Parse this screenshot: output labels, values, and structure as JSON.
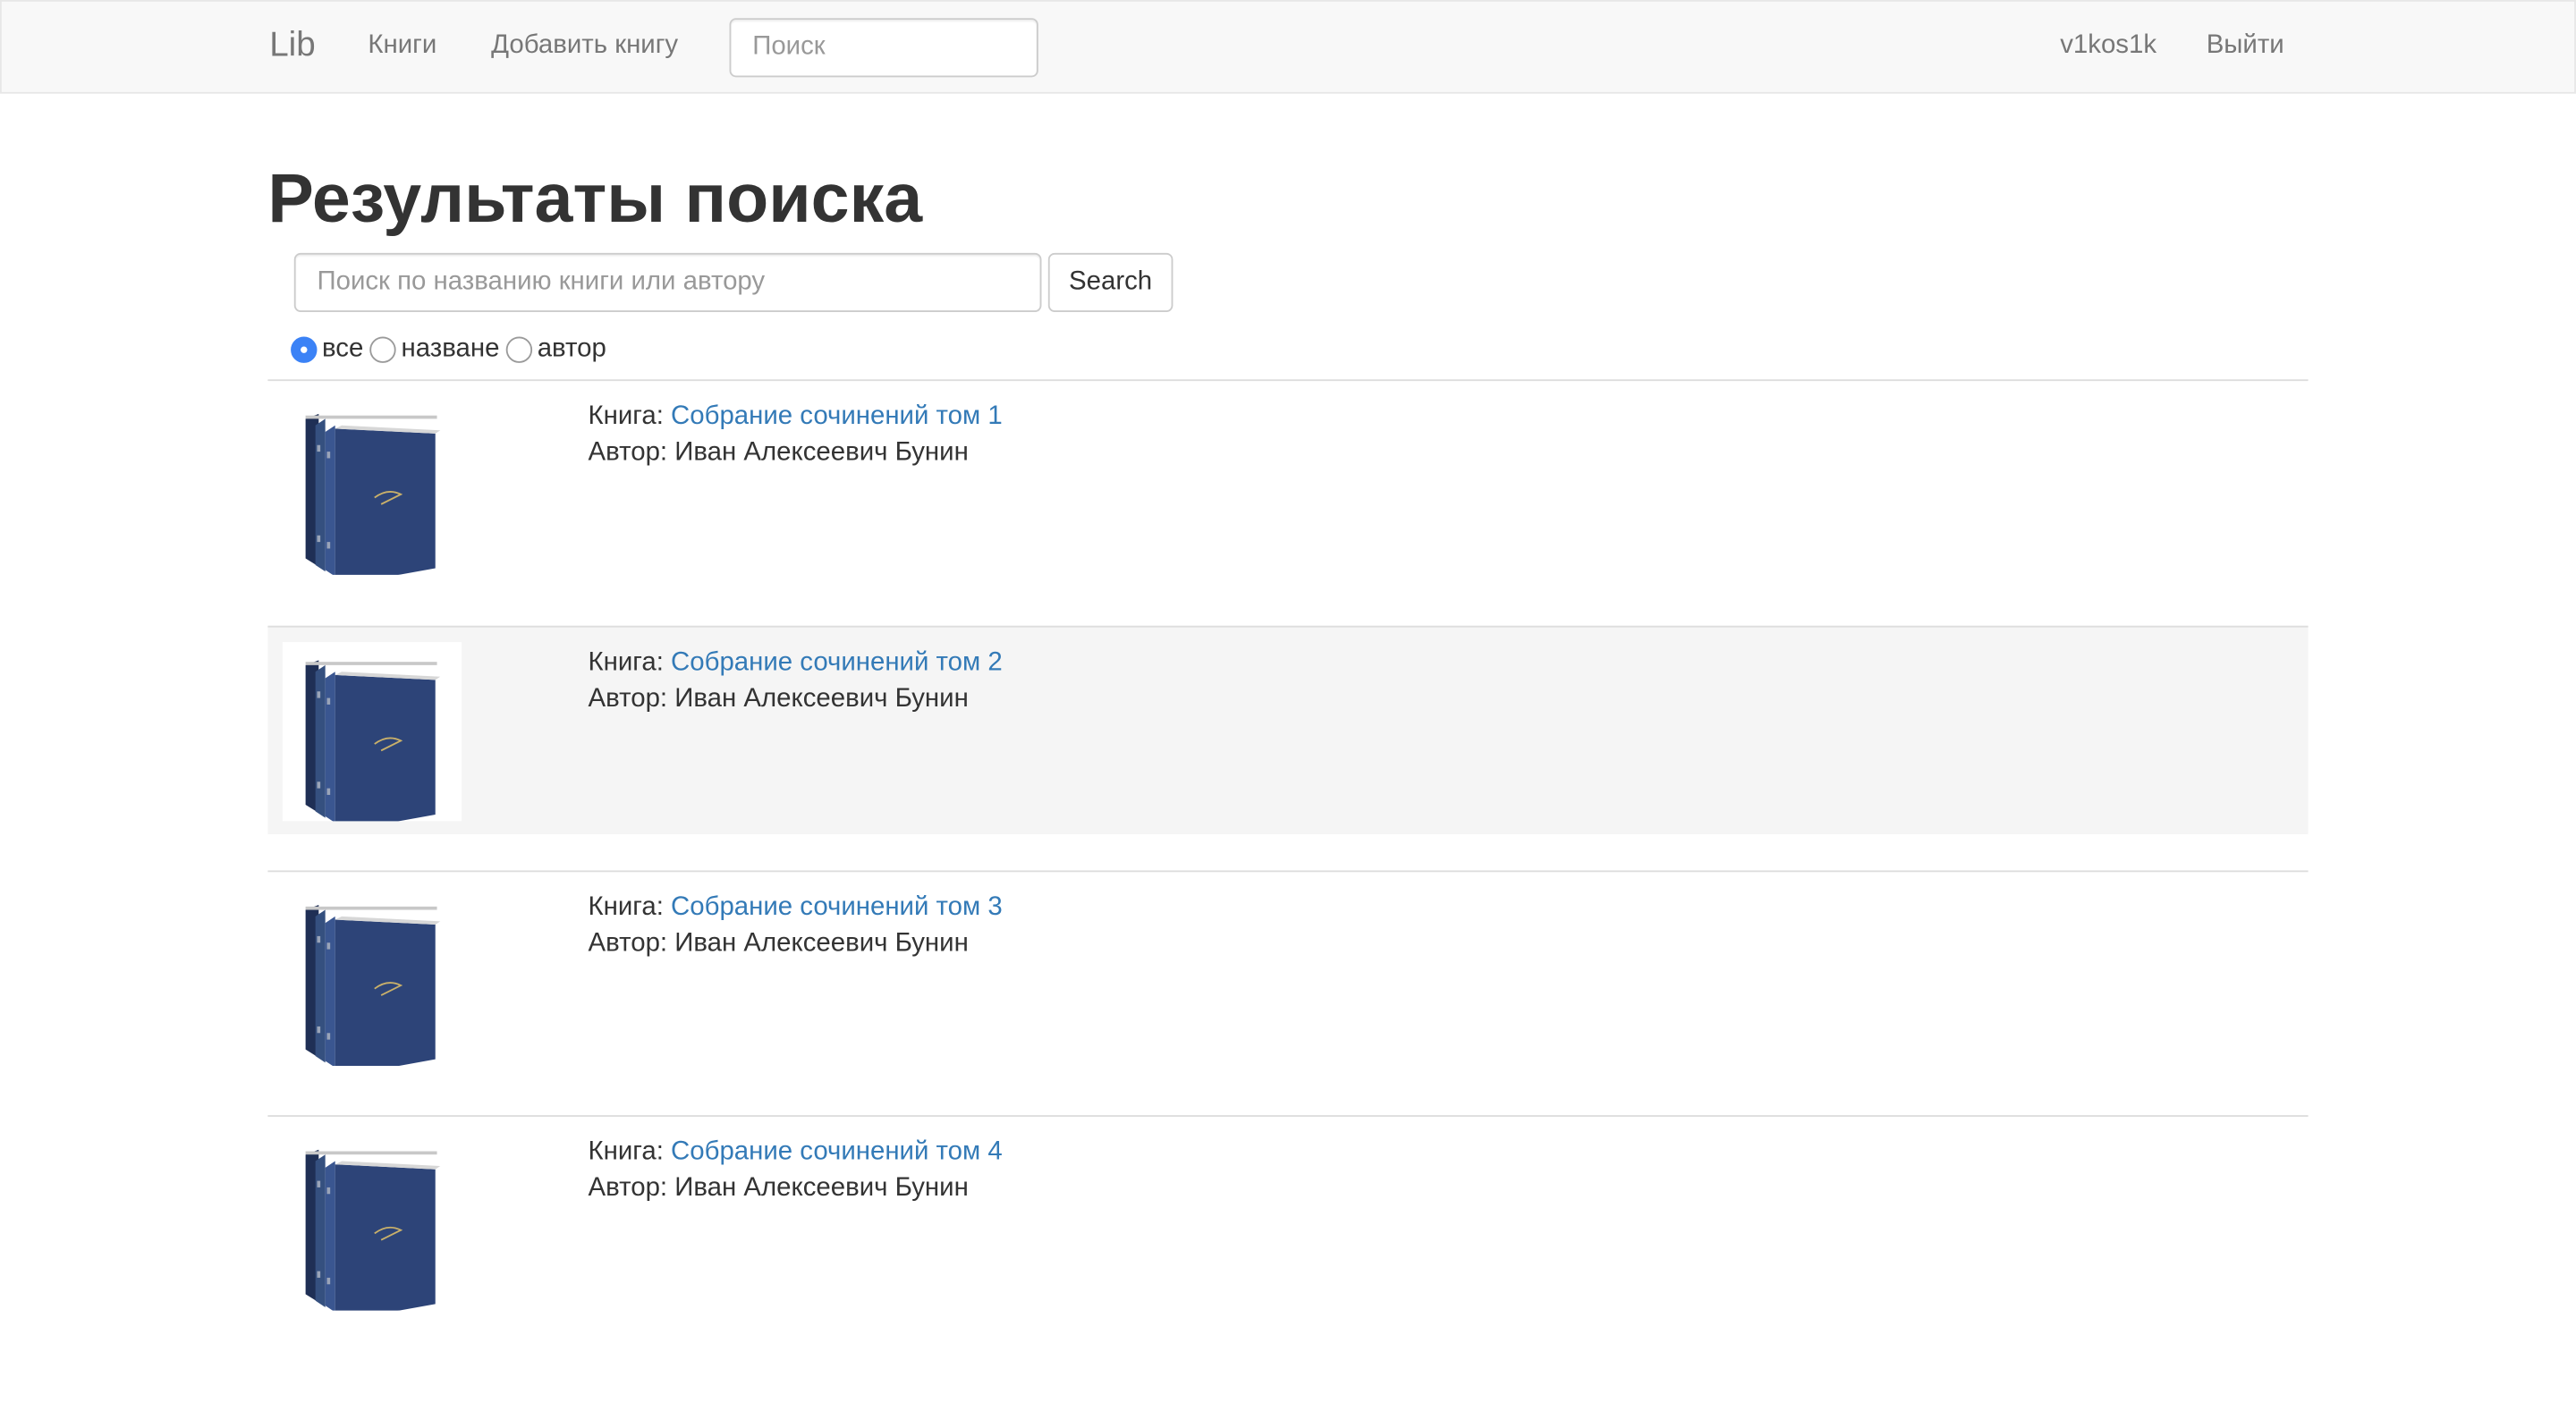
{
  "navbar": {
    "brand": "Lib",
    "links": [
      "Книги",
      "Добавить книгу"
    ],
    "search_placeholder": "Поиск",
    "user": "v1kos1k",
    "logout": "Выйти"
  },
  "main": {
    "title": "Результаты поиска",
    "search_placeholder": "Поиск по названию книги или автору",
    "search_button": "Search",
    "filters": [
      {
        "label": "все",
        "checked": true
      },
      {
        "label": "назване",
        "checked": false
      },
      {
        "label": "автор",
        "checked": false
      }
    ]
  },
  "books": [
    {
      "book_label": "Книга:",
      "title": "Собрание сочинений том 1",
      "author_label": "Автор:",
      "author": "Иван Алексеевич Бунин"
    },
    {
      "book_label": "Книга:",
      "title": "Собрание сочинений том 2",
      "author_label": "Автор:",
      "author": "Иван Алексеевич Бунин"
    },
    {
      "book_label": "Книга:",
      "title": "Собрание сочинений том 3",
      "author_label": "Автор:",
      "author": "Иван Алексеевич Бунин"
    },
    {
      "book_label": "Книга:",
      "title": "Собрание сочинений том 4",
      "author_label": "Автор:",
      "author": "Иван Алексеевич Бунин"
    }
  ],
  "colors": {
    "link": "#337ab7",
    "navbar_bg": "#f8f8f8",
    "radio_checked": "#3b82f6",
    "highlight_row": "#f5f5f5",
    "book_cover": "#2d4478"
  }
}
